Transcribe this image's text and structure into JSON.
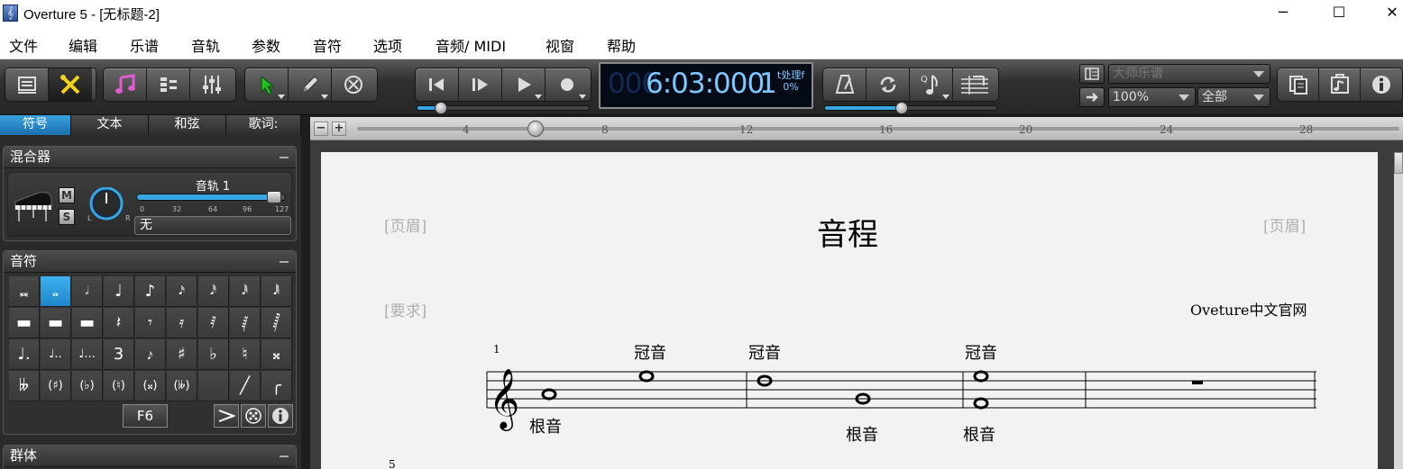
{
  "titlebar": {
    "title": "Overture 5 - [无标题-2]",
    "minimize": "─",
    "maximize": "☐",
    "close": "✕"
  },
  "menu": [
    "文件",
    "编辑",
    "乐谱",
    "音轨",
    "参数",
    "音符",
    "选项",
    "音频/ MIDI",
    "视窗",
    "帮助"
  ],
  "lcd": {
    "ghost": "000",
    "time": "6:03:000",
    "beat": "1",
    "processing_label": "t处理f",
    "processing_value": "0%"
  },
  "view_combo": {
    "value": "大师乐谱"
  },
  "zoom_combo": {
    "value": "100%"
  },
  "scope_combo": {
    "value": "全部"
  },
  "left_tabs": [
    "符号",
    "文本",
    "和弦",
    "歌词:"
  ],
  "mixer": {
    "title": "混合器",
    "track_name": "音轨 1",
    "mute": "M",
    "solo": "S",
    "pan_left": "L",
    "pan_right": "R",
    "scale": [
      "0",
      "32",
      "64",
      "96",
      "127"
    ],
    "volume_fraction": 0.96,
    "instrument": "无"
  },
  "notes_panel": {
    "title": "音符",
    "rows": [
      [
        "𝅜",
        "𝅝",
        "𝅗𝅥",
        "♩",
        "♪",
        "𝅘𝅥𝅯",
        "𝅘𝅥𝅰",
        "𝅘𝅥𝅱",
        "𝅘𝅥𝅲"
      ],
      [
        "▬",
        "▬",
        "▬",
        "𝄽",
        "𝄾",
        "𝄿",
        "𝅀",
        "𝅁",
        "𝅂"
      ],
      [
        "♩.",
        "♩..",
        "♩...",
        "3",
        "𝆔",
        "♯",
        "♭",
        "♮",
        "𝄪"
      ],
      [
        "𝄫",
        "(♯)",
        "(♭)",
        "(♮)",
        "(𝄪)",
        "(𝄫)",
        "",
        "╱",
        "╭"
      ]
    ],
    "selected": [
      0,
      1
    ],
    "key_label": "F6"
  },
  "groups_panel": {
    "title": "群体"
  },
  "ruler": {
    "marks": [
      "4",
      "8",
      "12",
      "16",
      "20",
      "24",
      "28"
    ],
    "zoom_out": "−",
    "zoom_in": "+"
  },
  "score": {
    "header_left": "[页眉]",
    "header_right": "[页眉]",
    "title": "音程",
    "requirement": "[要求]",
    "composer": "Oveture中文官网",
    "measure_number": "1",
    "next_system_number": "5",
    "labels": {
      "crown1": "冠音",
      "crown2": "冠音",
      "crown3": "冠音",
      "root1": "根音",
      "root2": "根音",
      "root3": "根音"
    }
  },
  "colors": {
    "accent": "#36a6e4",
    "lcd_text": "#7fc8ff",
    "lcd_bg": "#050b16",
    "page_bg": "#f2f2f0"
  }
}
